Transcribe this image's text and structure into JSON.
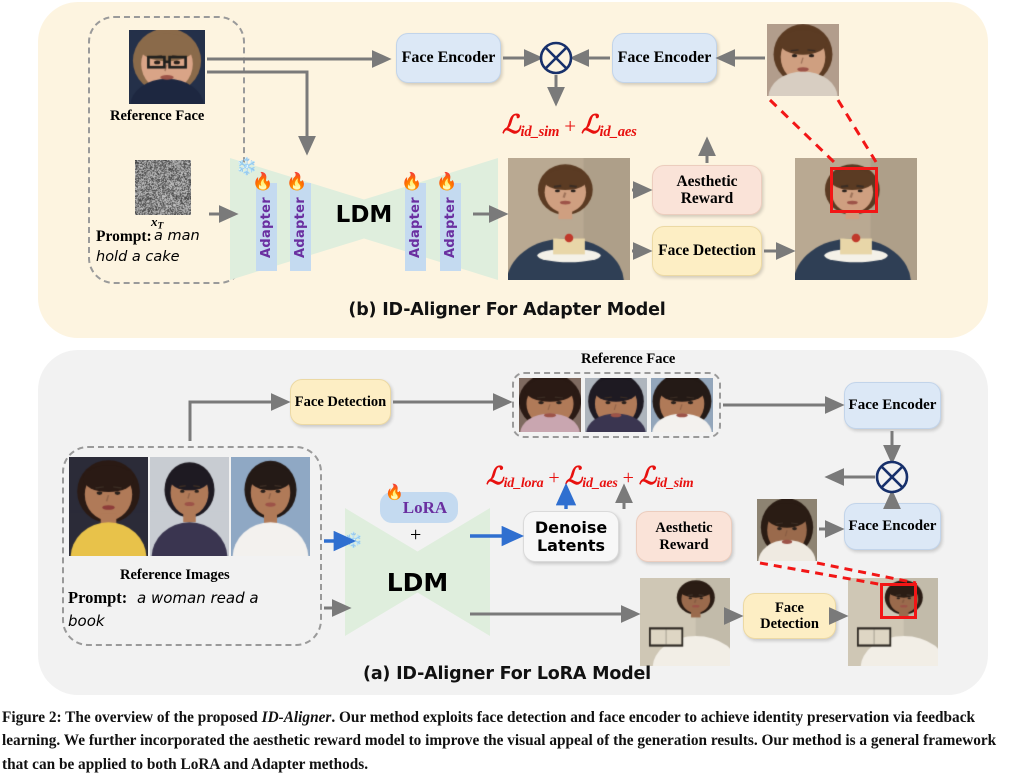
{
  "figure": {
    "caption_prefix": "Figure 2:",
    "caption_part1": " The overview of the proposed ",
    "caption_italic": "ID-Aligner",
    "caption_part2": ". Our method exploits face detection and face encoder to achieve identity preservation via feedback learning. We further incorporated the aesthetic reward model to improve the visual appeal of the generation results. Our method is a general framework that can be applied to both LoRA and Adapter methods."
  },
  "panel_b": {
    "caption": "(b) ID-Aligner For Adapter Model",
    "background_color": "#fdf4e0",
    "reference_face_label": "Reference Face",
    "xt_label": "xT",
    "prompt_label": "Prompt:",
    "prompt_line1": "a man",
    "prompt_line2": "hold a cake",
    "face_encoder_left": "Face Encoder",
    "face_encoder_right": "Face Encoder",
    "ldm_label": "LDM",
    "adapter_label": "Adapter",
    "adapter_count": 4,
    "aesthetic_reward": "Aesthetic Reward",
    "face_detection": "Face Detection",
    "loss": {
      "term1": "id_sim",
      "term2": "id_aes",
      "operator": "+",
      "symbol": "L",
      "color": "#e8110f"
    },
    "merge_icon": "cross-circle-icon",
    "frozen_icon": "snowflake-icon",
    "trainable_icon": "fire-icon"
  },
  "panel_a": {
    "caption": "(a) ID-Aligner For LoRA Model",
    "background_color": "#f2f2f2",
    "reference_images_label": "Reference Images",
    "reference_face_label": "Reference Face",
    "prompt_label": "Prompt:",
    "prompt_line1": "a woman read a",
    "prompt_line2": "book",
    "face_detection_top": "Face Detection",
    "face_detection_bottom": "Face Detection",
    "face_encoder_top": "Face Encoder",
    "face_encoder_bottom": "Face Encoder",
    "lora_label": "LoRA",
    "plus_label": "+",
    "ldm_label": "LDM",
    "denoise_latents": "Denoise Latents",
    "aesthetic_reward": "Aesthetic Reward",
    "loss": {
      "term1": "id_lora",
      "term2": "id_aes",
      "term3": "id_sim",
      "operator": "+",
      "symbol": "L",
      "color": "#e8110f"
    },
    "merge_icon": "cross-circle-icon",
    "frozen_icon": "snowflake-icon",
    "trainable_icon": "fire-icon"
  },
  "colors": {
    "accent_blue": "#2f6fd0",
    "arrow_gray": "#7a7a7a",
    "loss_red": "#e8110f",
    "detection_red": "#f21616",
    "box_blue": "#dce8f6",
    "box_yellow": "#fdeec4",
    "box_pink": "#fae3d8",
    "ldm_green": "#dfeedd",
    "adapter_blue": "#c4daf0",
    "adapter_text_purple": "#6a2fa0"
  }
}
